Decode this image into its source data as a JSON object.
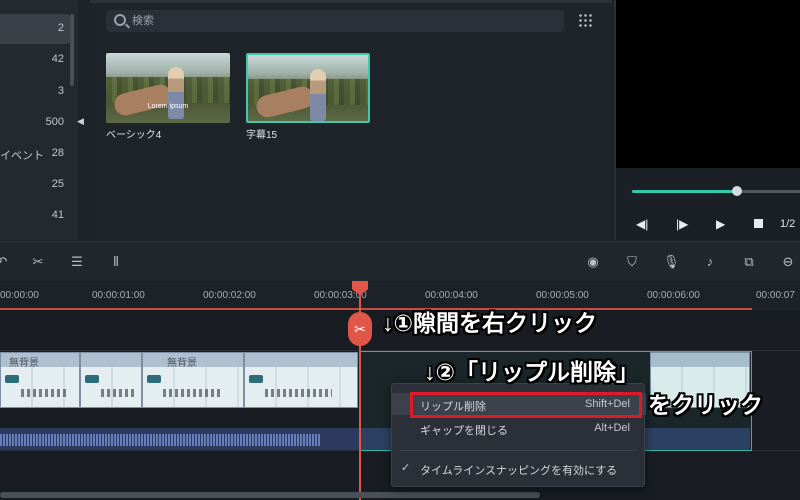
{
  "library": {
    "items": [
      {
        "label": "",
        "count": "2",
        "active": true
      },
      {
        "label": "",
        "count": "42"
      },
      {
        "label": "",
        "count": "3"
      },
      {
        "label": "",
        "count": "500"
      },
      {
        "label": "イベント",
        "count": "28"
      },
      {
        "label": "",
        "count": "25"
      },
      {
        "label": "",
        "count": "41"
      }
    ],
    "collapse_icon": "caret-left-icon"
  },
  "media": {
    "search_placeholder": "検索",
    "thumbnails": [
      {
        "label": "ベーシック4",
        "caption": "Lorem ipsum",
        "selected": false
      },
      {
        "label": "字幕15",
        "caption": "",
        "selected": true
      }
    ]
  },
  "player": {
    "progress": 0.62,
    "controls": [
      "prev-frame-icon",
      "next-frame-icon",
      "play-icon",
      "stop-icon"
    ],
    "page_ratio": "1/2"
  },
  "toolbar": {
    "left_icons": [
      "undo-icon",
      "scissors-icon",
      "adjust-icon",
      "audio-wave-icon"
    ],
    "right_icons": [
      "render-icon",
      "marker-icon",
      "mic-icon",
      "voiceover-icon",
      "split-screen-icon",
      "zoom-out-icon"
    ]
  },
  "ruler": {
    "ticks": [
      "00:00:00",
      "00:00:01:00",
      "00:00:02:00",
      "00:00:03:00",
      "00:00:04:00",
      "00:00:05:00",
      "00:00:06:00",
      "00:00:07"
    ]
  },
  "clips": {
    "title": "無背景"
  },
  "context_menu": {
    "items": [
      {
        "label": "リップル削除",
        "shortcut": "Shift+Del",
        "highlighted": true
      },
      {
        "label": "ギャップを閉じる",
        "shortcut": "Alt+Del"
      },
      {
        "label": "タイムラインスナッピングを有効にする",
        "shortcut": "",
        "checked": true
      }
    ]
  },
  "annotations": {
    "step1": "↓①隙間を右クリック",
    "step2": "↓②「リップル削除」",
    "step3": "をクリック"
  },
  "colors": {
    "accent": "#34c9ae",
    "playhead": "#e0574a",
    "highlight_box": "#e0192a"
  }
}
